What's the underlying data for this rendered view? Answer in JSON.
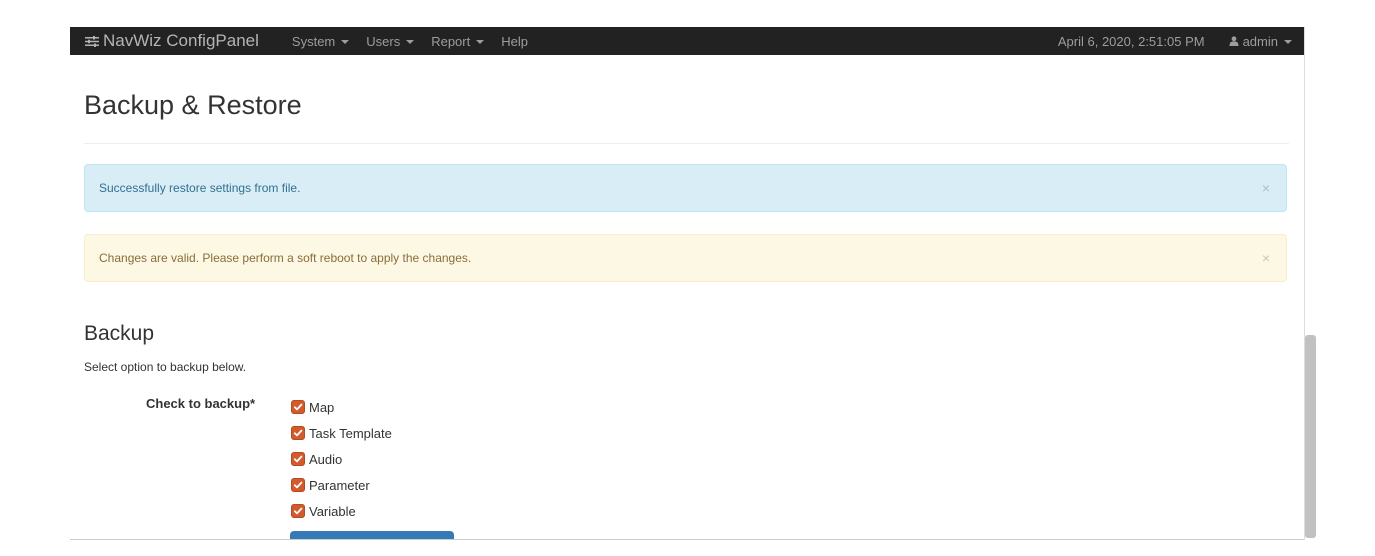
{
  "navbar": {
    "brand": "NavWiz ConfigPanel",
    "menus": [
      {
        "label": "System"
      },
      {
        "label": "Users"
      },
      {
        "label": "Report"
      },
      {
        "label": "Help"
      }
    ],
    "datetime": "April 6, 2020, 2:51:05 PM",
    "user": "admin",
    "background": "#222222"
  },
  "page": {
    "title": "Backup & Restore"
  },
  "alerts": {
    "info": {
      "message": "Successfully restore settings from file.",
      "close": "×",
      "color": "#d9edf7"
    },
    "warning": {
      "message": "Changes are valid. Please perform a soft reboot to apply the changes.",
      "close": "×",
      "color": "#fcf8e3"
    }
  },
  "backup": {
    "title": "Backup",
    "help": "Select option to backup below.",
    "label": "Check to backup*",
    "options": [
      {
        "label": "Map",
        "checked": true
      },
      {
        "label": "Task Template",
        "checked": true
      },
      {
        "label": "Audio",
        "checked": true
      },
      {
        "label": "Parameter",
        "checked": true
      },
      {
        "label": "Variable",
        "checked": true
      }
    ],
    "checkbox_color": "#d35a2b",
    "button_color": "#337ab7"
  }
}
